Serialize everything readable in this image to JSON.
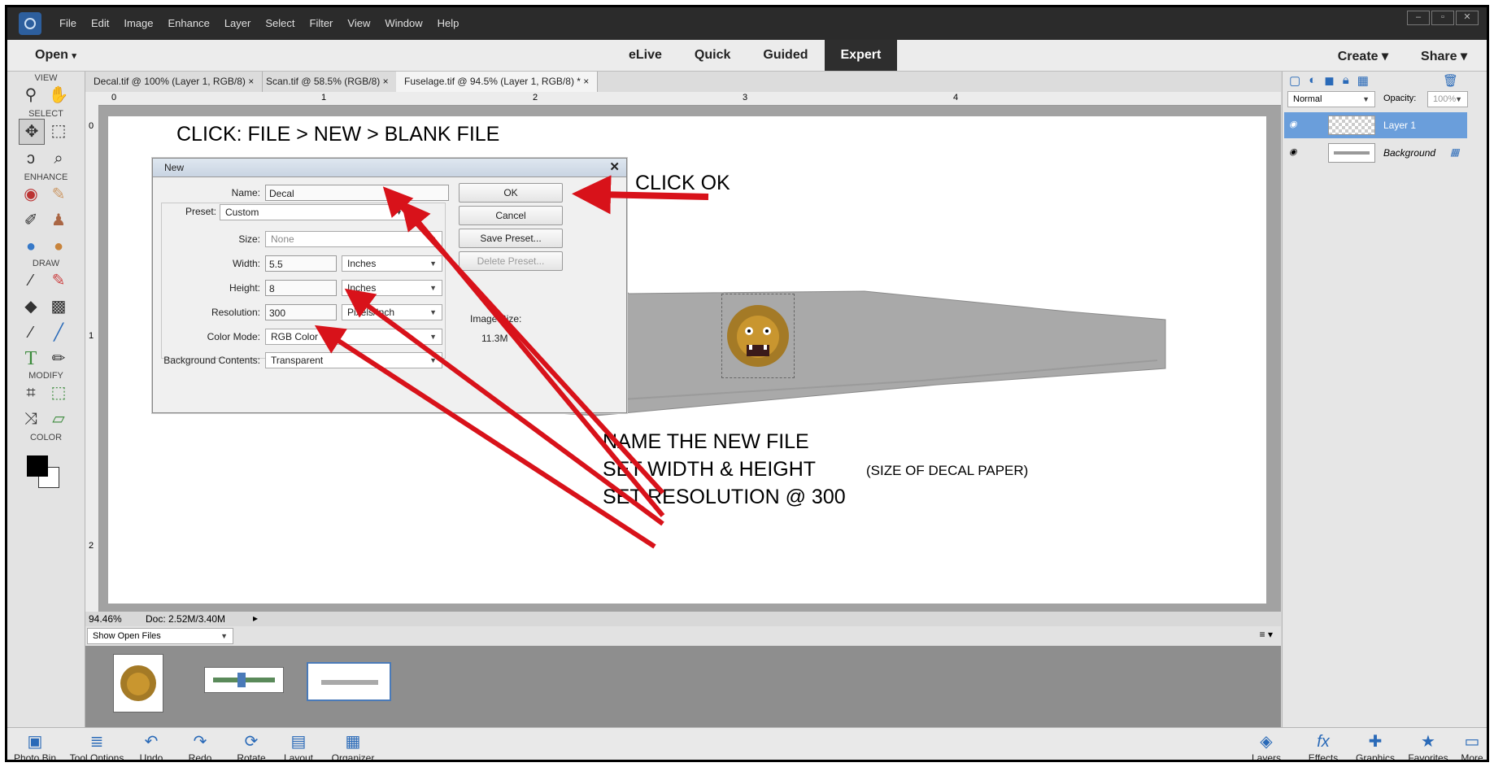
{
  "menubar": {
    "items": [
      "File",
      "Edit",
      "Image",
      "Enhance",
      "Layer",
      "Select",
      "Filter",
      "View",
      "Window",
      "Help"
    ]
  },
  "modebar": {
    "open": "Open",
    "modes": [
      "eLive",
      "Quick",
      "Guided",
      "Expert"
    ],
    "create": "Create",
    "share": "Share"
  },
  "toolbox": {
    "sections": [
      "VIEW",
      "SELECT",
      "ENHANCE",
      "DRAW",
      "MODIFY",
      "COLOR"
    ]
  },
  "tabs": [
    "Decal.tif @ 100% (Layer 1, RGB/8)",
    "Scan.tif @ 58.5% (RGB/8)",
    "Fuselage.tif @ 94.5% (Layer 1, RGB/8) *"
  ],
  "ruler": {
    "h": [
      "0",
      "1",
      "2",
      "3",
      "4"
    ],
    "v": [
      "0",
      "1",
      "2"
    ]
  },
  "annotations": {
    "header": "CLICK: FILE > NEW > BLANK FILE",
    "click_ok": "CLICK OK",
    "name_file": "NAME THE NEW FILE",
    "set_wh": "SET WIDTH & HEIGHT",
    "decal_size": "(SIZE OF DECAL PAPER)",
    "set_res": "SET RESOLUTION @ 300"
  },
  "dialog": {
    "title": "New",
    "name_label": "Name:",
    "name_value": "Decal",
    "preset_label": "Preset:",
    "preset_value": "Custom",
    "size_label": "Size:",
    "size_value": "None",
    "width_label": "Width:",
    "width_value": "5.5",
    "width_unit": "Inches",
    "height_label": "Height:",
    "height_value": "8",
    "height_unit": "Inches",
    "resolution_label": "Resolution:",
    "resolution_value": "300",
    "resolution_unit": "Pixels/Inch",
    "colormode_label": "Color Mode:",
    "colormode_value": "RGB Color",
    "bg_label": "Background Contents:",
    "bg_value": "Transparent",
    "ok": "OK",
    "cancel": "Cancel",
    "save_preset": "Save Preset...",
    "delete_preset": "Delete Preset...",
    "image_size_label": "Image Size:",
    "image_size_value": "11.3M"
  },
  "layers": {
    "blend": "Normal",
    "opacity_label": "Opacity:",
    "opacity_value": "100%",
    "items": [
      "Layer 1",
      "Background"
    ]
  },
  "status": {
    "zoom": "94.46%",
    "doc": "Doc: 2.52M/3.40M"
  },
  "bin": {
    "dropdown": "Show Open Files"
  },
  "taskbar": {
    "left": [
      "Photo Bin",
      "Tool Options",
      "Undo",
      "Redo",
      "Rotate",
      "Layout",
      "Organizer"
    ],
    "right": [
      "Layers",
      "Effects",
      "Graphics",
      "Favorites",
      "More"
    ]
  },
  "colors": {
    "accent": "#3d7fcc",
    "arrow": "#d8121a",
    "menu_bg": "#2b2b2b"
  }
}
